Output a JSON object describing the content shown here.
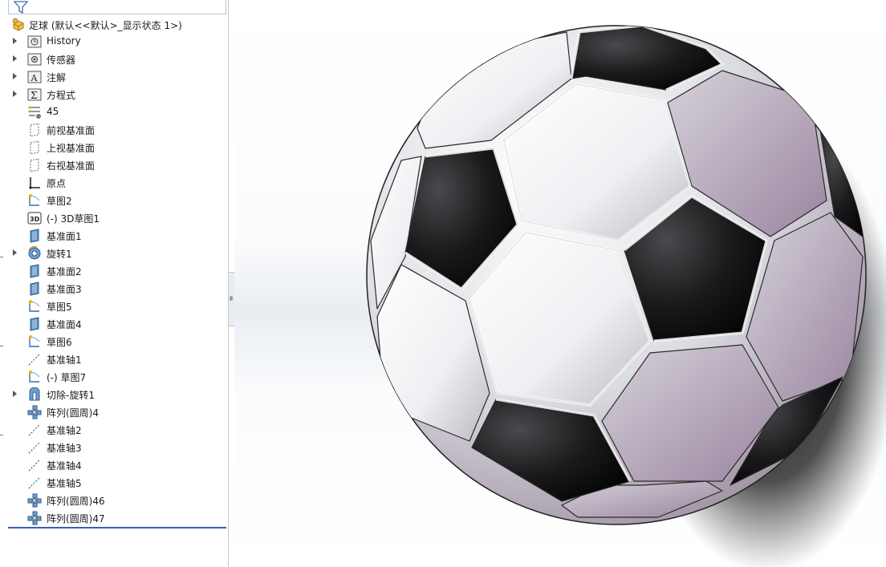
{
  "app": {
    "accent": "#3261b5"
  },
  "feature_tree": {
    "filter_icon": "funnel-icon",
    "root": {
      "label": "足球  (默认<<默认>_显示状态 1>)",
      "icon": "part-icon"
    },
    "items": [
      {
        "label": "History",
        "icon": "history-folder-icon",
        "expandable": true
      },
      {
        "label": "传感器",
        "icon": "sensors-folder-icon",
        "expandable": true
      },
      {
        "label": "注解",
        "icon": "annotations-folder-icon",
        "expandable": true
      },
      {
        "label": "方程式",
        "icon": "equations-folder-icon",
        "expandable": true
      },
      {
        "label": "45",
        "icon": "material-icon",
        "expandable": false
      },
      {
        "label": "前视基准面",
        "icon": "plane-icon",
        "expandable": false
      },
      {
        "label": "上视基准面",
        "icon": "plane-icon",
        "expandable": false
      },
      {
        "label": "右视基准面",
        "icon": "plane-icon",
        "expandable": false
      },
      {
        "label": "原点",
        "icon": "origin-icon",
        "expandable": false
      },
      {
        "label": "草图2",
        "icon": "sketch-icon",
        "expandable": false
      },
      {
        "label": "(-) 3D草图1",
        "icon": "3d-sketch-icon",
        "expandable": false
      },
      {
        "label": "基准面1",
        "icon": "ref-plane-icon",
        "expandable": false
      },
      {
        "label": "旋转1",
        "icon": "revolve-icon",
        "expandable": true
      },
      {
        "label": "基准面2",
        "icon": "ref-plane-icon",
        "expandable": false
      },
      {
        "label": "基准面3",
        "icon": "ref-plane-icon",
        "expandable": false
      },
      {
        "label": "草图5",
        "icon": "sketch-icon",
        "expandable": false
      },
      {
        "label": "基准面4",
        "icon": "ref-plane-icon",
        "expandable": false
      },
      {
        "label": "草图6",
        "icon": "sketch-icon",
        "expandable": false
      },
      {
        "label": "基准轴1",
        "icon": "axis-icon",
        "expandable": false
      },
      {
        "label": "(-) 草图7",
        "icon": "sketch-icon",
        "expandable": false
      },
      {
        "label": "切除-旋转1",
        "icon": "cut-revolve-icon",
        "expandable": true
      },
      {
        "label": "阵列(圆周)4",
        "icon": "circular-pattern-icon",
        "expandable": false
      },
      {
        "label": "基准轴2",
        "icon": "axis-icon",
        "expandable": false
      },
      {
        "label": "基准轴3",
        "icon": "axis-icon",
        "expandable": false
      },
      {
        "label": "基准轴4",
        "icon": "axis-icon",
        "expandable": false
      },
      {
        "label": "基准轴5",
        "icon": "axis-icon",
        "expandable": false
      },
      {
        "label": "阵列(圆周)46",
        "icon": "circular-pattern-icon",
        "expandable": false
      },
      {
        "label": "阵列(圆周)47",
        "icon": "circular-pattern-icon",
        "expandable": false
      }
    ]
  },
  "viewport": {
    "model": "soccer-ball-model",
    "shadow": "drop-shadow"
  }
}
